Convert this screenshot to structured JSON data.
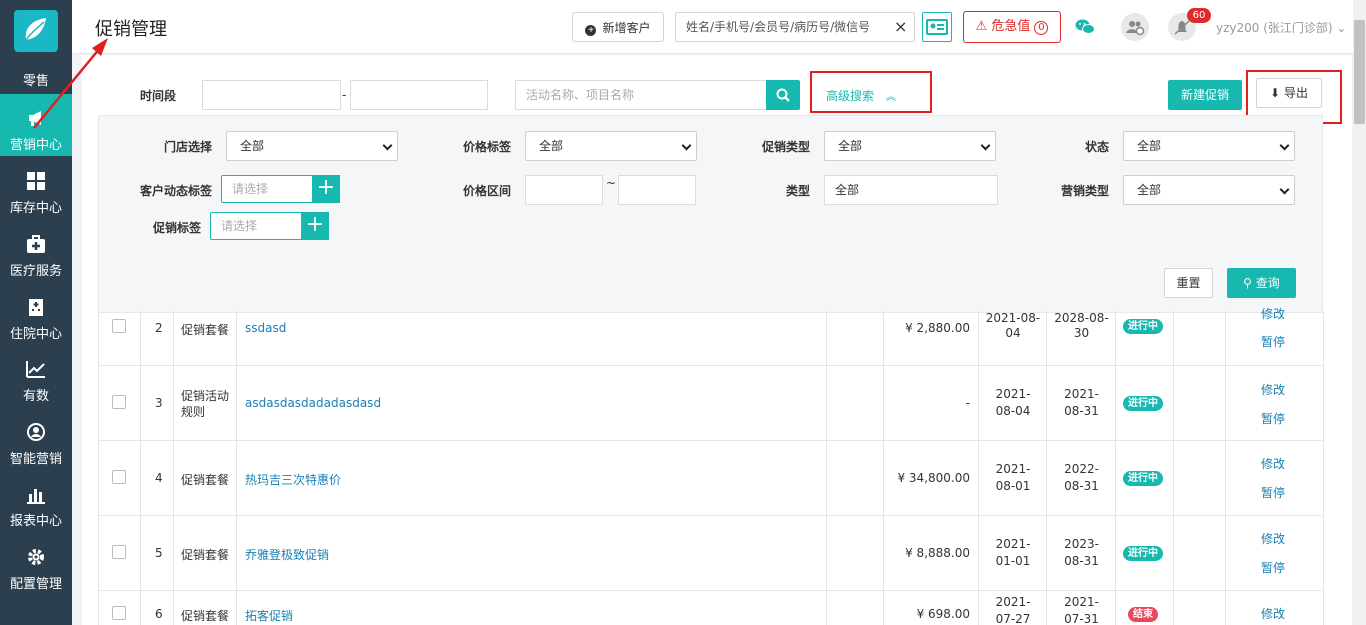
{
  "sidebar": {
    "items": [
      {
        "label": "零售",
        "icon": "retail-icon"
      },
      {
        "label": "营销中心",
        "icon": "megaphone-icon"
      },
      {
        "label": "库存中心",
        "icon": "grid-icon"
      },
      {
        "label": "医疗服务",
        "icon": "medical-kit-icon"
      },
      {
        "label": "住院中心",
        "icon": "hospital-icon"
      },
      {
        "label": "有数",
        "icon": "trend-chart-icon"
      },
      {
        "label": "智能营销",
        "icon": "smart-marketing-icon"
      },
      {
        "label": "报表中心",
        "icon": "bar-chart-icon"
      },
      {
        "label": "配置管理",
        "icon": "gear-icon"
      }
    ],
    "active_index": 1
  },
  "header": {
    "title": "促销管理",
    "new_customer_label": "新增客户",
    "patient_search_placeholder": "姓名/手机号/会员号/病历号/微信号",
    "clear_symbol": "×",
    "danger_label": "危急值",
    "danger_count": "0",
    "notification_count": "60",
    "user_label": "yzy200 (张江门诊部)",
    "accent_color": "#16b8b0",
    "danger_color": "#e02b2b"
  },
  "toolbar": {
    "time_label": "时间段",
    "date_separator": "-",
    "keyword_placeholder": "活动名称、项目名称",
    "advanced_search_label": "高级搜索",
    "new_promo_label": "新建促销",
    "export_label": "导出"
  },
  "filters": {
    "store": {
      "label": "门店选择",
      "value": "全部"
    },
    "price_tag": {
      "label": "价格标签",
      "value": "全部"
    },
    "promo_type": {
      "label": "促销类型",
      "value": "全部"
    },
    "status": {
      "label": "状态",
      "value": "全部"
    },
    "customer_tag": {
      "label": "客户动态标签",
      "placeholder": "请选择"
    },
    "price_range": {
      "label": "价格区间",
      "separator": "~"
    },
    "type": {
      "label": "类型",
      "value": "全部"
    },
    "marketing_type": {
      "label": "营销类型",
      "value": "全部"
    },
    "promo_tag": {
      "label": "促销标签",
      "placeholder": "请选择"
    },
    "reset_label": "重置",
    "query_label": "查询"
  },
  "table": {
    "rows": [
      {
        "no": "2",
        "type": "促销套餐",
        "name": "ssdasd",
        "price": "¥ 2,880.00",
        "start": "2021-08-04",
        "end": "2028-08-30",
        "status": "进行中",
        "ops": [
          "修改",
          "暂停"
        ]
      },
      {
        "no": "3",
        "type": "促销活动规则",
        "name": "asdasdasdadadasdasd",
        "price": "-",
        "start": "2021-08-04",
        "end": "2021-08-31",
        "status": "进行中",
        "ops": [
          "修改",
          "暂停"
        ]
      },
      {
        "no": "4",
        "type": "促销套餐",
        "name": "热玛吉三次特惠价",
        "price": "¥ 34,800.00",
        "start": "2021-08-01",
        "end": "2022-08-31",
        "status": "进行中",
        "ops": [
          "修改",
          "暂停"
        ]
      },
      {
        "no": "5",
        "type": "促销套餐",
        "name": "乔雅登极致促销",
        "price": "¥ 8,888.00",
        "start": "2021-01-01",
        "end": "2023-08-31",
        "status": "进行中",
        "ops": [
          "修改",
          "暂停"
        ]
      },
      {
        "no": "6",
        "type": "促销套餐",
        "name": "拓客促销",
        "price": "¥ 698.00",
        "start": "2021-07-27",
        "end": "2021-07-31",
        "status": "结束",
        "ops": [
          "修改"
        ]
      }
    ]
  }
}
